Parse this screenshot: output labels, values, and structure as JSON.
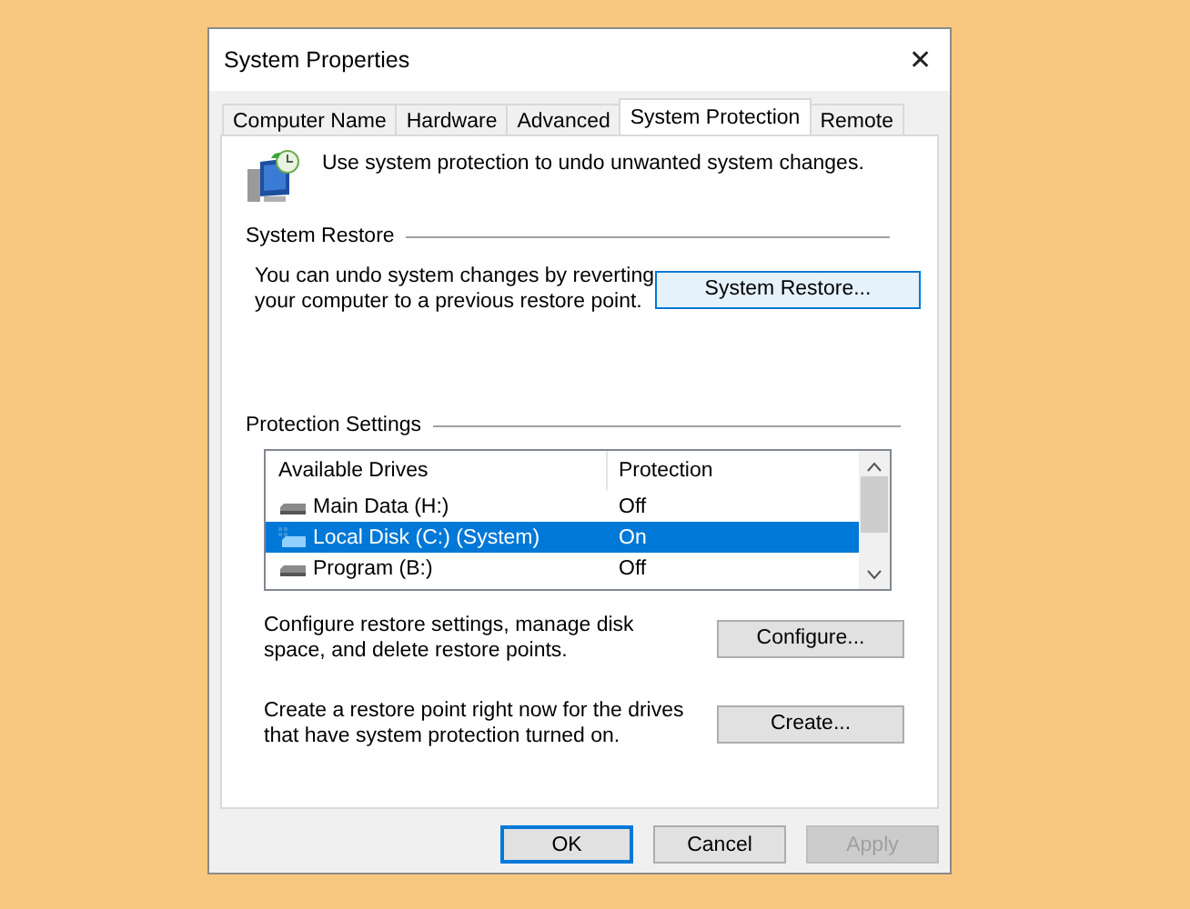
{
  "window": {
    "title": "System Properties",
    "close": "✕"
  },
  "tabs": [
    {
      "label": "Computer Name",
      "selected": false
    },
    {
      "label": "Hardware",
      "selected": false
    },
    {
      "label": "Advanced",
      "selected": false
    },
    {
      "label": "System Protection",
      "selected": true
    },
    {
      "label": "Remote",
      "selected": false
    }
  ],
  "intro": "Use system protection to undo unwanted system changes.",
  "system_restore": {
    "heading": "System Restore",
    "text": "You can undo system changes by reverting your computer to a previous restore point.",
    "button": "System Restore..."
  },
  "protection_settings": {
    "heading": "Protection Settings",
    "columns": [
      "Available Drives",
      "Protection"
    ],
    "drives": [
      {
        "name": "Main Data (H:)",
        "protection": "Off",
        "kind": "data",
        "selected": false
      },
      {
        "name": "Local Disk (C:) (System)",
        "protection": "On",
        "kind": "system",
        "selected": true
      },
      {
        "name": "Program (B:)",
        "protection": "Off",
        "kind": "data",
        "selected": false
      }
    ],
    "actions": [
      {
        "text": "Configure restore settings, manage disk space, and delete restore points.",
        "button": "Configure..."
      },
      {
        "text": "Create a restore point right now for the drives that have system protection turned on.",
        "button": "Create..."
      }
    ]
  },
  "buttons": [
    {
      "label": "OK",
      "default": true,
      "disabled": false
    },
    {
      "label": "Cancel",
      "default": false,
      "disabled": false
    },
    {
      "label": "Apply",
      "default": false,
      "disabled": true
    }
  ]
}
